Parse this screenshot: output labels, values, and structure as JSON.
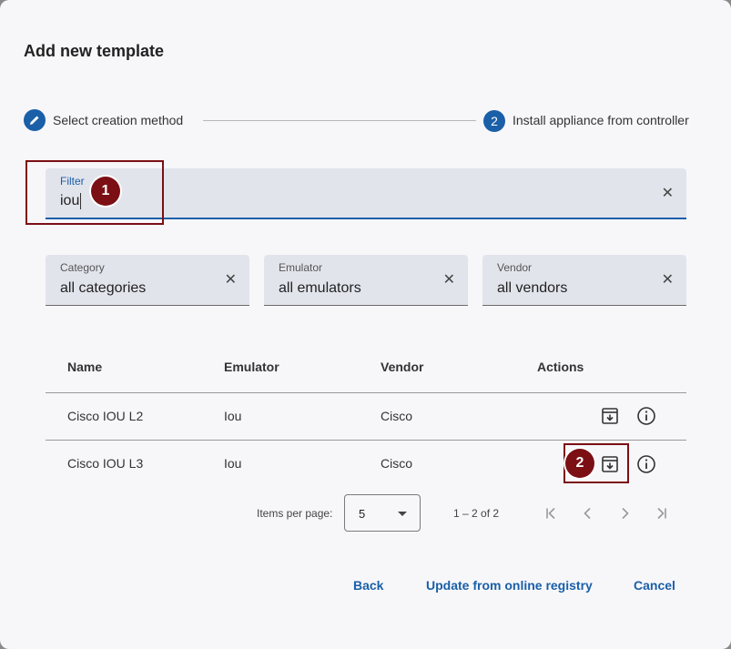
{
  "dialog": {
    "title": "Add new template"
  },
  "stepper": {
    "step1": {
      "icon": "pencil-icon",
      "label": "Select creation method"
    },
    "step2": {
      "number": "2",
      "label": "Install appliance from controller"
    }
  },
  "filter": {
    "label": "Filter",
    "value": "iou"
  },
  "selects": {
    "category": {
      "label": "Category",
      "value": "all categories"
    },
    "emulator": {
      "label": "Emulator",
      "value": "all emulators"
    },
    "vendor": {
      "label": "Vendor",
      "value": "all vendors"
    }
  },
  "table": {
    "headers": [
      "Name",
      "Emulator",
      "Vendor",
      "Actions"
    ],
    "rows": [
      {
        "name": "Cisco IOU L2",
        "emulator": "Iou",
        "vendor": "Cisco"
      },
      {
        "name": "Cisco IOU L3",
        "emulator": "Iou",
        "vendor": "Cisco"
      }
    ]
  },
  "paginator": {
    "items_per_page_label": "Items per page:",
    "page_size": "5",
    "range": "1 – 2 of 2"
  },
  "buttons": {
    "back": "Back",
    "update": "Update from online registry",
    "cancel": "Cancel"
  },
  "annotations": {
    "one": "1",
    "two": "2"
  },
  "colors": {
    "primary": "#1a5fa8",
    "annotation": "#7b0f14"
  }
}
